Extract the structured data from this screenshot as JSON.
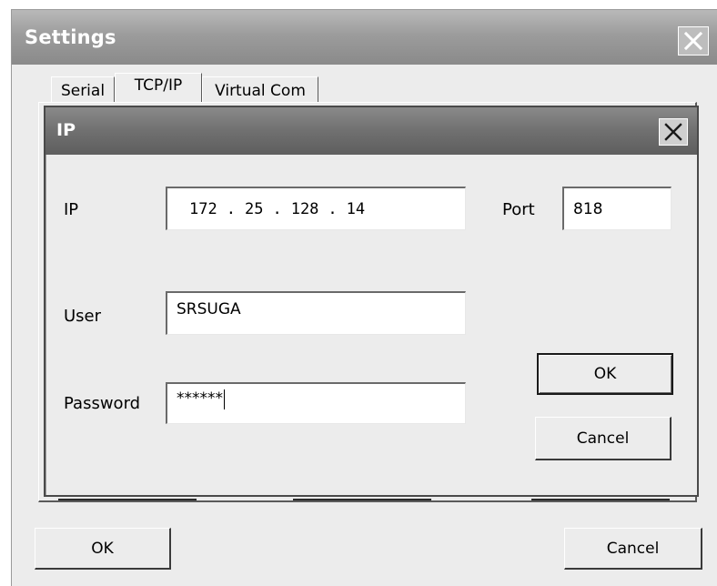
{
  "window": {
    "title": "Settings",
    "close_icon": "close-icon"
  },
  "tabs": [
    {
      "label": "Serial",
      "active": false
    },
    {
      "label": "TCP/IP",
      "active": true
    },
    {
      "label": "Virtual Com",
      "active": false
    }
  ],
  "dialog": {
    "title": "IP",
    "close_icon": "close-icon",
    "ip": {
      "label": "IP",
      "octets": [
        "172",
        "25",
        "128",
        "14"
      ],
      "separator": "."
    },
    "port": {
      "label": "Port",
      "value": "818"
    },
    "user": {
      "label": "User",
      "value": "SRSUGA"
    },
    "password": {
      "label": "Password",
      "value": "******"
    },
    "ok_label": "OK",
    "cancel_label": "Cancel"
  },
  "footer": {
    "ok_label": "OK",
    "cancel_label": "Cancel"
  },
  "colors": {
    "window_bg": "#ececec",
    "titlebar": "#8a8a8a",
    "title_text": "#ffffff"
  }
}
